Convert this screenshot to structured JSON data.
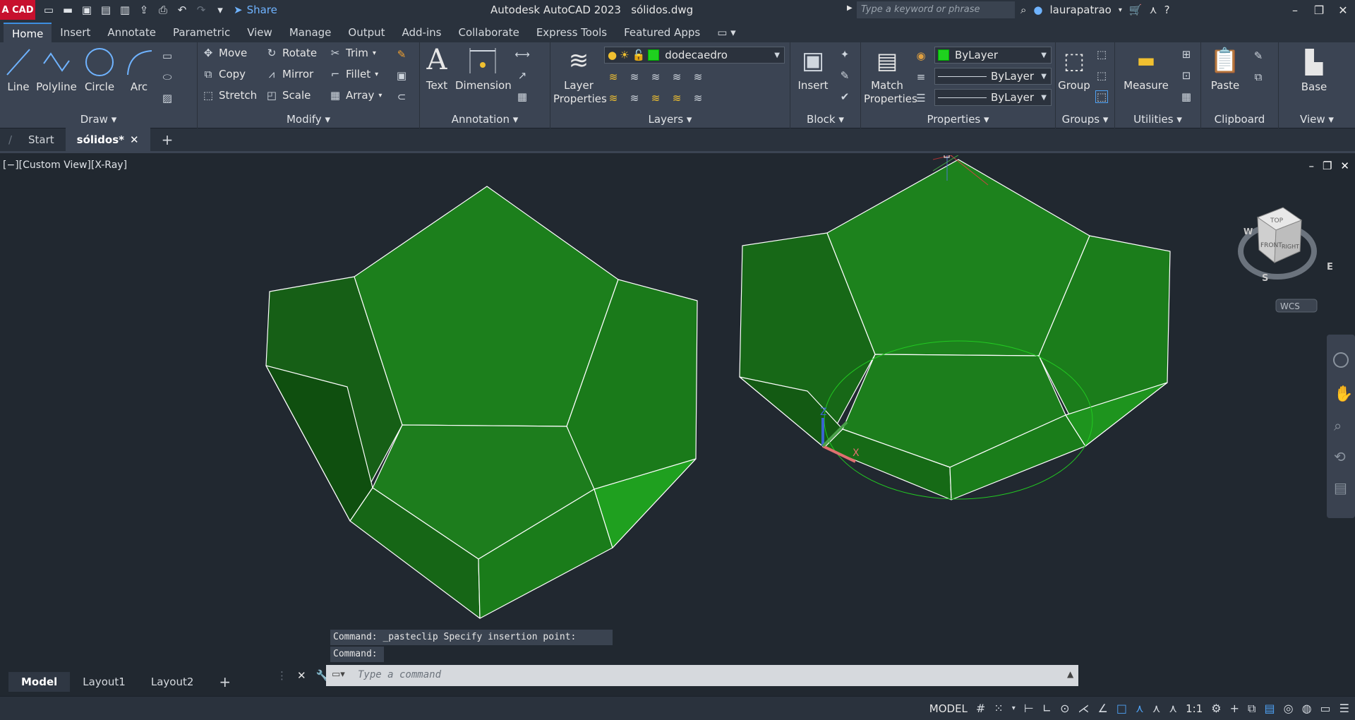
{
  "app": {
    "logo_text": "A CAD",
    "title": "Autodesk AutoCAD 2023",
    "filename": "sólidos.dwg",
    "share_label": "Share",
    "search_placeholder": "Type a keyword or phrase",
    "user": "laurapatrao"
  },
  "ribbon_tabs": [
    "Home",
    "Insert",
    "Annotate",
    "Parametric",
    "View",
    "Manage",
    "Output",
    "Add-ins",
    "Collaborate",
    "Express Tools",
    "Featured Apps"
  ],
  "ribbon": {
    "draw": {
      "title": "Draw",
      "line": "Line",
      "polyline": "Polyline",
      "circle": "Circle",
      "arc": "Arc"
    },
    "modify": {
      "title": "Modify",
      "move": "Move",
      "rotate": "Rotate",
      "trim": "Trim",
      "copy": "Copy",
      "mirror": "Mirror",
      "fillet": "Fillet",
      "stretch": "Stretch",
      "scale": "Scale",
      "array": "Array"
    },
    "annotation": {
      "title": "Annotation",
      "text": "Text",
      "dimension": "Dimension"
    },
    "layers": {
      "title": "Layers",
      "layer_properties": "Layer Properties",
      "current_layer": "dodecaedro"
    },
    "block": {
      "title": "Block",
      "insert": "Insert"
    },
    "properties": {
      "title": "Properties",
      "match": "Match Properties",
      "color": "ByLayer",
      "linetype": "ByLayer",
      "lineweight": "ByLayer"
    },
    "groups": {
      "title": "Groups",
      "group": "Group"
    },
    "utilities": {
      "title": "Utilities",
      "measure": "Measure"
    },
    "clipboard": {
      "title": "Clipboard",
      "paste": "Paste"
    },
    "view": {
      "title": "View",
      "base": "Base"
    }
  },
  "doc_tabs": {
    "start": "Start",
    "active": "sólidos*"
  },
  "viewport": {
    "label": "[−][Custom View][X-Ray]",
    "viewcube": {
      "top": "TOP",
      "front": "FRONT",
      "right": "RIGHT",
      "wcs": "WCS",
      "w": "W",
      "s": "S",
      "e": "E"
    }
  },
  "command": {
    "history": [
      "Command: _pasteclip Specify insertion point:",
      "Command:"
    ],
    "placeholder": "Type a command"
  },
  "layout_tabs": [
    "Model",
    "Layout1",
    "Layout2"
  ],
  "status": {
    "mode": "MODEL",
    "scale": "1:1"
  },
  "colors": {
    "accent": "#3d8ee0",
    "solid": "#1a8f1a",
    "edge": "#ffffff"
  }
}
